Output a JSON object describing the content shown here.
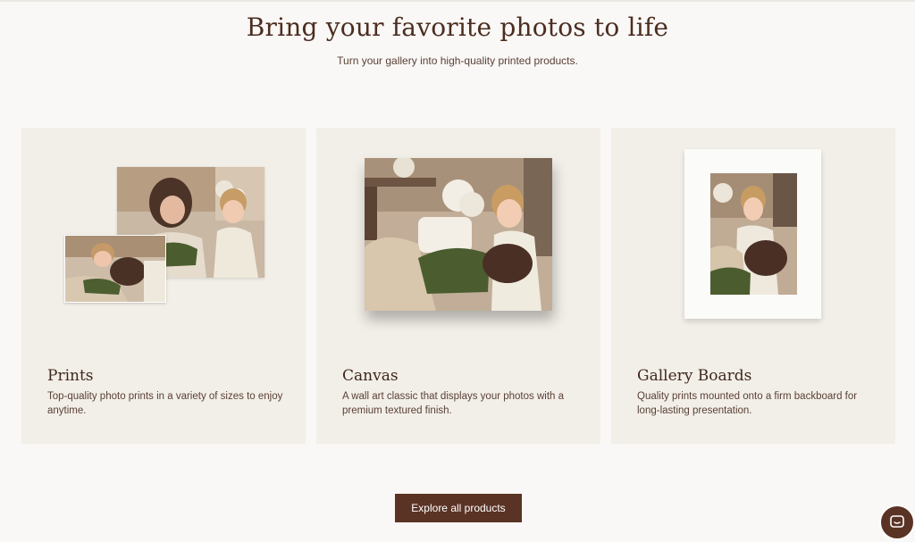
{
  "header": {
    "title": "Bring your favorite photos to life",
    "subtitle": "Turn your gallery into high-quality printed products."
  },
  "products": [
    {
      "title": "Prints",
      "description": "Top-quality photo prints in a variety of sizes to enjoy anytime."
    },
    {
      "title": "Canvas",
      "description": "A wall art classic that displays your photos with a premium textured finish."
    },
    {
      "title": "Gallery Boards",
      "description": "Quality prints mounted onto a firm backboard for long-lasting presentation."
    }
  ],
  "cta": {
    "label": "Explore all products"
  },
  "icons": {
    "chat": "chat-icon"
  },
  "colors": {
    "accent": "#5a3324",
    "card_bg": "#f2efe8",
    "page_bg": "#faf8f6"
  }
}
